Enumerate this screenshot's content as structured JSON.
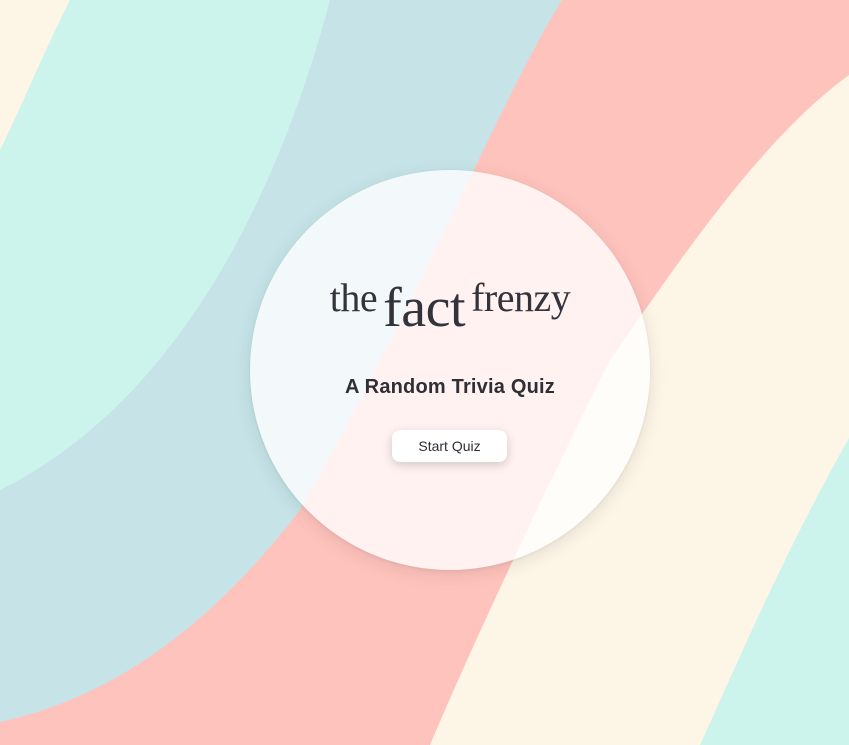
{
  "colors": {
    "cream": "#fdf5e6",
    "mint": "#cdf4ec",
    "teal": "#c6e4e8",
    "coral": "#ffc3bd",
    "text": "#33333b"
  },
  "title": {
    "part1": "the",
    "part2": "fact",
    "part3": "frenzy"
  },
  "subtitle": "A Random Trivia Quiz",
  "start_button_label": "Start Quiz"
}
